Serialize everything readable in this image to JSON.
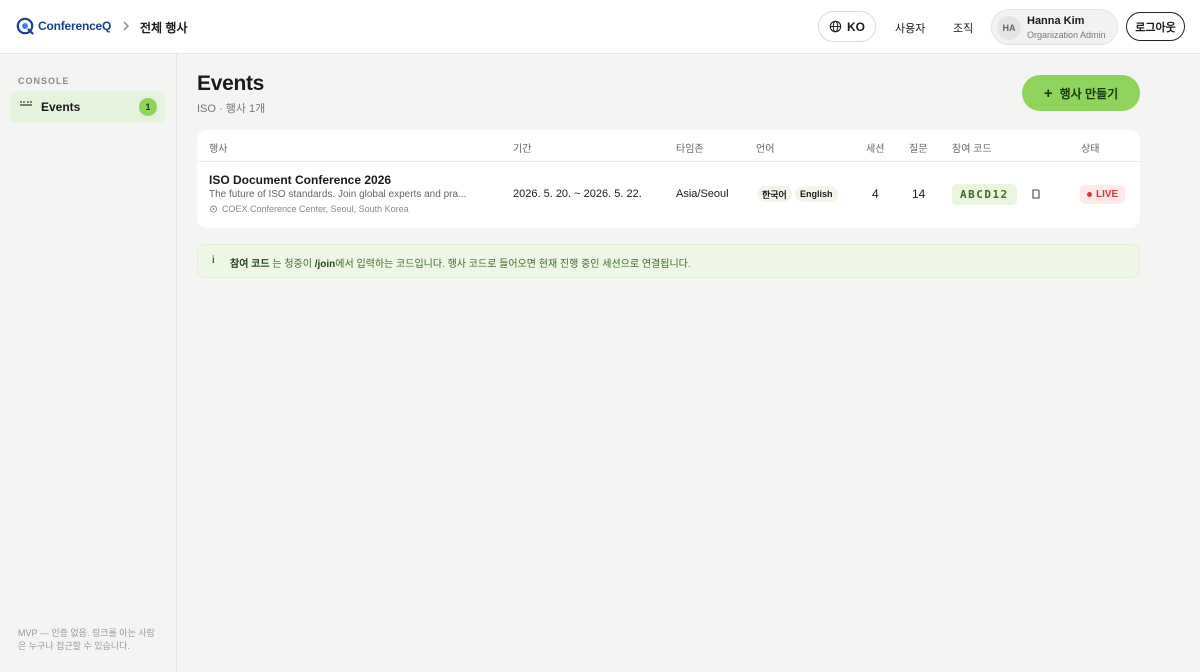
{
  "brand": {
    "name": "ConferenceQ",
    "color": "#1c3f8f"
  },
  "breadcrumb": {
    "current": "전체 행사"
  },
  "header": {
    "language": "KO",
    "nav_users": "사용자",
    "nav_org": "조직",
    "user": {
      "initials": "HA",
      "name": "Hanna Kim",
      "role": "Organization Admin"
    },
    "logout_label": "로그아웃"
  },
  "sidebar": {
    "section_label": "CONSOLE",
    "items": [
      {
        "label": "Events",
        "badge": "1"
      }
    ],
    "footer_note": "MVP — 인증 없음. 링크를 아는 사람은 누구나 접근할 수 있습니다."
  },
  "main": {
    "title": "Events",
    "subtitle": "ISO · 행사 1개",
    "create_label": "행사 만들기",
    "accent_color": "#8ed45c",
    "table": {
      "columns": [
        "행사",
        "기간",
        "타임존",
        "언어",
        "세션",
        "질문",
        "참여 코드",
        "상태"
      ],
      "rows": [
        {
          "title": "ISO Document Conference 2026",
          "description": "The future of ISO standards. Join global experts and pra...",
          "location": "COEX Conference Center, Seoul, South Korea",
          "period": "2026. 5. 20. ~ 2026. 5. 22.",
          "timezone": "Asia/Seoul",
          "languages": [
            "한국어",
            "English"
          ],
          "sessions": "4",
          "questions": "14",
          "join_code": "ABCD12",
          "status": "LIVE",
          "status_color": "#cf3b3b"
        }
      ]
    },
    "info": {
      "term": "참여 코드",
      "text_a": " 는 청중이 ",
      "path": "/join",
      "text_b": "에서 입력하는 코드입니다. 행사 코드로 들어오면 현재 진행 중인 세션으로 연결됩니다."
    }
  }
}
